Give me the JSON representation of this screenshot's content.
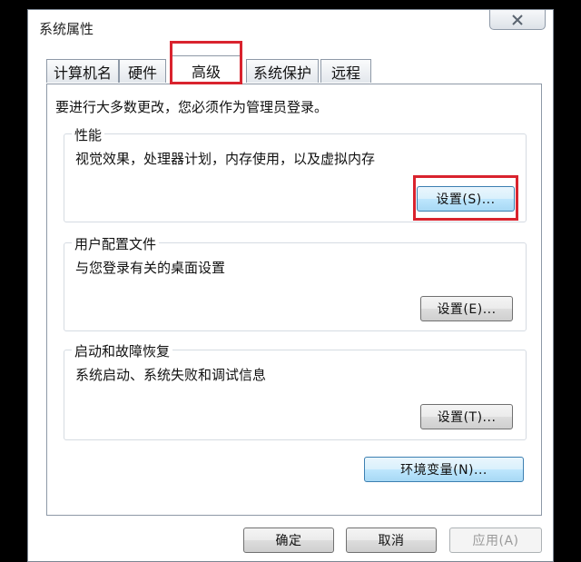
{
  "window": {
    "title": "系统属性"
  },
  "tabs": [
    {
      "label": "计算机名"
    },
    {
      "label": "硬件"
    },
    {
      "label": "高级"
    },
    {
      "label": "系统保护"
    },
    {
      "label": "远程"
    }
  ],
  "active_tab": "高级",
  "admin_notice": "要进行大多数更改，您必须作为管理员登录。",
  "performance": {
    "title": "性能",
    "description": "视觉效果，处理器计划，内存使用，以及虚拟内存",
    "settings_label": "设置(S)..."
  },
  "user_profiles": {
    "title": "用户配置文件",
    "description": "与您登录有关的桌面设置",
    "settings_label": "设置(E)..."
  },
  "startup_recovery": {
    "title": "启动和故障恢复",
    "description": "系统启动、系统失败和调试信息",
    "settings_label": "设置(T)..."
  },
  "env_vars_label": "环境变量(N)...",
  "footer": {
    "ok_label": "确定",
    "cancel_label": "取消",
    "apply_label": "应用(A)"
  },
  "colors": {
    "annotation_red": "#d9232e",
    "focused_button_border": "#3c7fb1"
  },
  "icons": {
    "close": "close-icon"
  }
}
